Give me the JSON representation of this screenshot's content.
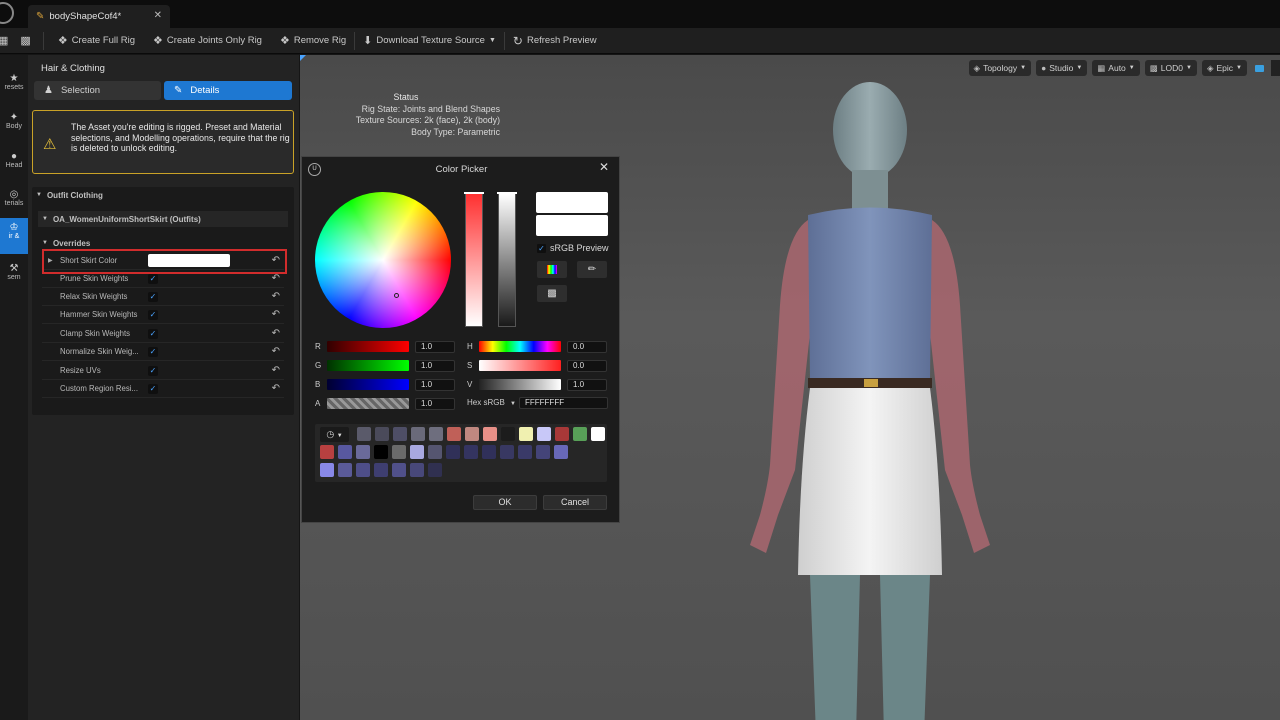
{
  "titlebar": {
    "tab_label": "bodyShapeCof4*",
    "close_glyph": "✕"
  },
  "toolbar": {
    "create_full_rig": "Create Full Rig",
    "create_joints_only_rig": "Create Joints Only Rig",
    "remove_rig": "Remove Rig",
    "download_texture_source": "Download Texture Source",
    "refresh_preview": "Refresh Preview"
  },
  "leftstrip": {
    "items": [
      {
        "label": "resets",
        "icon": "star-icon"
      },
      {
        "label": "Body",
        "icon": "body-icon"
      },
      {
        "label": "Head",
        "icon": "head-icon"
      },
      {
        "label": "terials",
        "icon": "materials-icon"
      },
      {
        "label": "ir &",
        "icon": "hair-clothing-icon"
      },
      {
        "label": "sem",
        "icon": "hammer-icon"
      }
    ]
  },
  "panel": {
    "title": "Hair & Clothing",
    "selection_label": "Selection",
    "details_label": "Details",
    "warning_text": "The Asset you're editing is rigged. Preset and Material selections, and Modelling operations, require that the rig is deleted to unlock editing.",
    "outfit_clothing": "Outfit Clothing",
    "outfit_name": "OA_WomenUniformShortSkirt (Outfits)",
    "overrides": "Overrides",
    "properties": [
      {
        "label": "Short Skirt Color",
        "type": "color",
        "value": "#FFFFFF"
      },
      {
        "label": "Prune Skin Weights",
        "type": "bool",
        "value": true
      },
      {
        "label": "Relax Skin Weights",
        "type": "bool",
        "value": true
      },
      {
        "label": "Hammer Skin Weights",
        "type": "bool",
        "value": true
      },
      {
        "label": "Clamp Skin Weights",
        "type": "bool",
        "value": true
      },
      {
        "label": "Normalize Skin Weig...",
        "type": "bool",
        "value": true
      },
      {
        "label": "Resize UVs",
        "type": "bool",
        "value": true
      },
      {
        "label": "Custom Region Resi...",
        "type": "bool",
        "value": true
      }
    ]
  },
  "viewport": {
    "buttons": {
      "topology": "Topology",
      "studio": "Studio",
      "auto": "Auto",
      "lod": "LOD0",
      "epic": "Epic"
    },
    "status": {
      "title": "Status",
      "rig_state": "Rig State: Joints and Blend Shapes",
      "texture_sources": "Texture Sources: 2k (face), 2k (body)",
      "body_type": "Body Type: Parametric"
    }
  },
  "color_picker": {
    "title": "Color Picker",
    "srgb_preview": "sRGB Preview",
    "channels": {
      "r": {
        "label": "R",
        "value": "1.0"
      },
      "g": {
        "label": "G",
        "value": "1.0"
      },
      "b": {
        "label": "B",
        "value": "1.0"
      },
      "a": {
        "label": "A",
        "value": "1.0"
      },
      "h": {
        "label": "H",
        "value": "0.0"
      },
      "s": {
        "label": "S",
        "value": "0.0"
      },
      "v": {
        "label": "V",
        "value": "1.0"
      }
    },
    "hex_label": "Hex sRGB",
    "hex_value": "FFFFFFFF",
    "ok": "OK",
    "cancel": "Cancel",
    "swatches": [
      "#5a5a6a",
      "#4a4a5a",
      "#4e4e66",
      "#6a6a7a",
      "#6e6e7e",
      "#c06058",
      "#c08880",
      "#e89088",
      "#1c1c1c",
      "#f0f0b0",
      "#c8c8f8",
      "#a83838",
      "#58a058",
      "#ffffff",
      "#b84040",
      "#5858a0",
      "#6a6a9a",
      "#000000",
      "#6a6a6a",
      "#a8a8e0",
      "#555570",
      "#303058",
      "#343460",
      "#30305a",
      "#383862",
      "#3a3a68",
      "#444478",
      "#6868b8",
      "#8888e8",
      "#5a5a98",
      "#4e4e88",
      "#3e3e70",
      "#50508a",
      "#48487a",
      "#303050"
    ]
  }
}
